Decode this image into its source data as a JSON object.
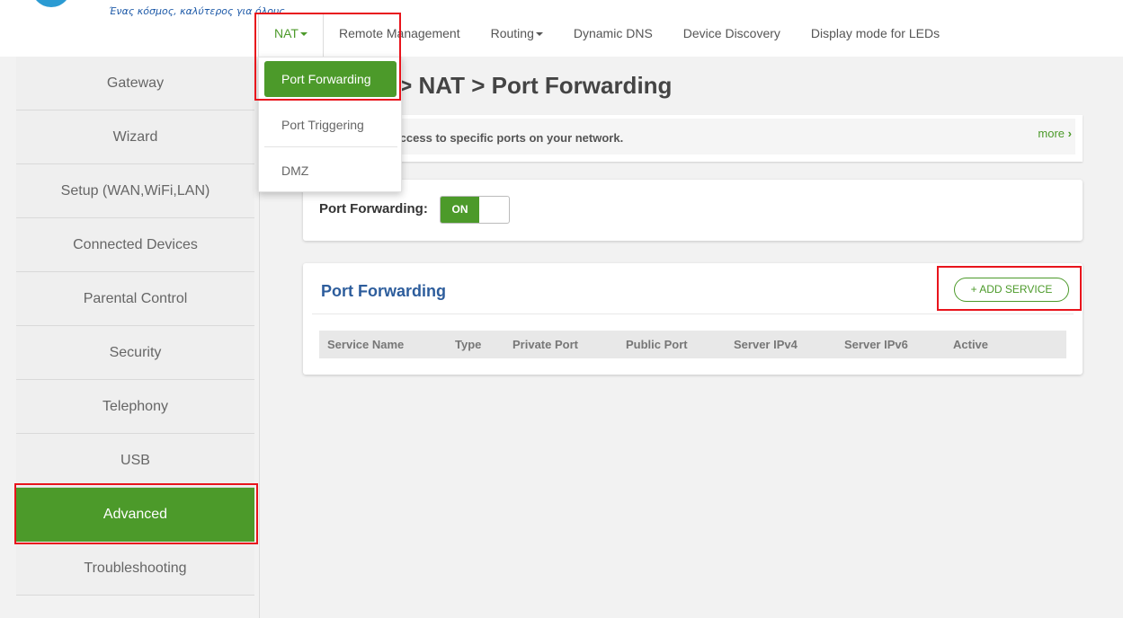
{
  "header": {
    "slogan": "Ένας κόσμος, καλύτερος για όλους."
  },
  "topnav": [
    {
      "label": "NAT",
      "has_caret": true,
      "active": true
    },
    {
      "label": "Remote Management"
    },
    {
      "label": "Routing",
      "has_caret": true
    },
    {
      "label": "Dynamic DNS"
    },
    {
      "label": "Device Discovery"
    },
    {
      "label": "Display mode for LEDs"
    }
  ],
  "nat_dropdown": {
    "items": [
      "Port Forwarding",
      "Port Triggering",
      "DMZ"
    ],
    "selected": "Port Forwarding"
  },
  "sidebar": {
    "items": [
      "Gateway",
      "Wizard",
      "Setup (WAN,WiFi,LAN)",
      "Connected Devices",
      "Parental Control",
      "Security",
      "Telephony",
      "USB",
      "Advanced",
      "Troubleshooting"
    ],
    "active": "Advanced"
  },
  "main": {
    "title": "d > NAT > Port Forwarding",
    "info_text": "al access to specific ports on your network.",
    "more_label": "more",
    "toggle_label": "Port Forwarding:",
    "toggle_state": "ON",
    "table_title": "Port Forwarding",
    "add_button": "+ ADD SERVICE",
    "columns": [
      "Service Name",
      "Type",
      "Private Port",
      "Public Port",
      "Server IPv4",
      "Server IPv6",
      "Active"
    ]
  },
  "colors": {
    "accent_green": "#4c9a2a",
    "title_blue": "#2d5d9c",
    "highlight_red": "#e8141c"
  }
}
